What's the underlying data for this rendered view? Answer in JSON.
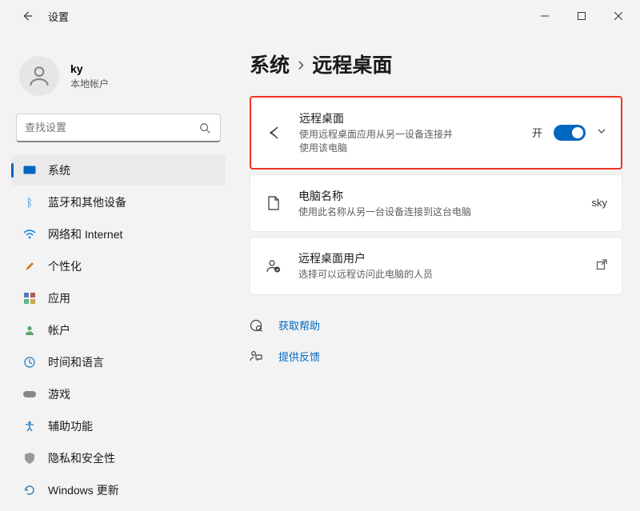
{
  "titlebar": {
    "app_title": "设置"
  },
  "user": {
    "name": "ky",
    "type": "本地帐户"
  },
  "search": {
    "placeholder": "查找设置"
  },
  "nav": [
    {
      "label": "系统",
      "selected": true
    },
    {
      "label": "蓝牙和其他设备"
    },
    {
      "label": "网络和 Internet"
    },
    {
      "label": "个性化"
    },
    {
      "label": "应用"
    },
    {
      "label": "帐户"
    },
    {
      "label": "时间和语言"
    },
    {
      "label": "游戏"
    },
    {
      "label": "辅助功能"
    },
    {
      "label": "隐私和安全性"
    },
    {
      "label": "Windows 更新"
    }
  ],
  "breadcrumb": {
    "root": "系统",
    "sep": "›",
    "page": "远程桌面"
  },
  "cards": {
    "remote": {
      "title": "远程桌面",
      "desc": "使用远程桌面应用从另一设备连接并使用该电脑",
      "state_label": "开"
    },
    "pcname": {
      "title": "电脑名称",
      "desc": "使用此名称从另一台设备连接到这台电脑",
      "value": "sky"
    },
    "users": {
      "title": "远程桌面用户",
      "desc": "选择可以远程访问此电脑的人员"
    }
  },
  "links": {
    "help": "获取帮助",
    "feedback": "提供反馈"
  }
}
